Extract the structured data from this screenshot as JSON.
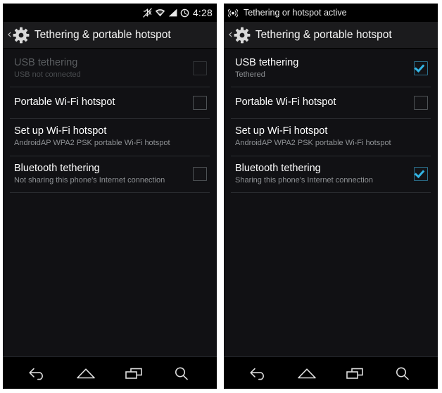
{
  "panels": [
    {
      "id": "left",
      "statusbar": {
        "icons": [
          "mute-icon",
          "wifi-icon",
          "signal-icon",
          "alarm-icon"
        ],
        "clock": "4:28",
        "notification_text": ""
      },
      "actionbar": {
        "back_label": "‹",
        "icon": "gear-icon",
        "title": "Tethering & portable hotspot"
      },
      "rows": [
        {
          "name": "usb-tethering",
          "title": "USB tethering",
          "summary": "USB not connected",
          "checked": false,
          "disabled": true
        },
        {
          "name": "portable-wifi-hotspot",
          "title": "Portable Wi-Fi hotspot",
          "summary": "",
          "checked": false,
          "disabled": false
        },
        {
          "name": "set-up-wifi-hotspot",
          "title": "Set up Wi-Fi hotspot",
          "summary": "AndroidAP WPA2 PSK portable Wi-Fi hotspot",
          "checked": null,
          "disabled": false
        },
        {
          "name": "bluetooth-tethering",
          "title": "Bluetooth tethering",
          "summary": "Not sharing this phone's Internet connection",
          "checked": false,
          "disabled": false
        }
      ],
      "navbar": [
        "back-icon",
        "home-icon",
        "recents-icon",
        "search-icon"
      ]
    },
    {
      "id": "right",
      "statusbar": {
        "icons": [
          "hotspot-icon"
        ],
        "clock": "",
        "notification_text": "Tethering or hotspot active"
      },
      "actionbar": {
        "back_label": "‹",
        "icon": "gear-icon",
        "title": "Tethering & portable hotspot"
      },
      "rows": [
        {
          "name": "usb-tethering",
          "title": "USB tethering",
          "summary": "Tethered",
          "checked": true,
          "disabled": false
        },
        {
          "name": "portable-wifi-hotspot",
          "title": "Portable Wi-Fi hotspot",
          "summary": "",
          "checked": false,
          "disabled": false
        },
        {
          "name": "set-up-wifi-hotspot",
          "title": "Set up Wi-Fi hotspot",
          "summary": "AndroidAP WPA2 PSK portable Wi-Fi hotspot",
          "checked": null,
          "disabled": false
        },
        {
          "name": "bluetooth-tethering",
          "title": "Bluetooth tethering",
          "summary": "Sharing this phone's Internet connection",
          "checked": true,
          "disabled": false
        }
      ],
      "navbar": [
        "back-icon",
        "home-icon",
        "recents-icon",
        "search-icon"
      ]
    }
  ],
  "colors": {
    "accent": "#33b5e5",
    "screen_bg": "#111114",
    "actionbar_bg": "#1b1b1d",
    "statusbar_bg": "#000000",
    "divider": "#2b2d31",
    "title_text": "#ffffff",
    "summary_text": "#8f9295",
    "disabled_text": "#5a5d60"
  }
}
